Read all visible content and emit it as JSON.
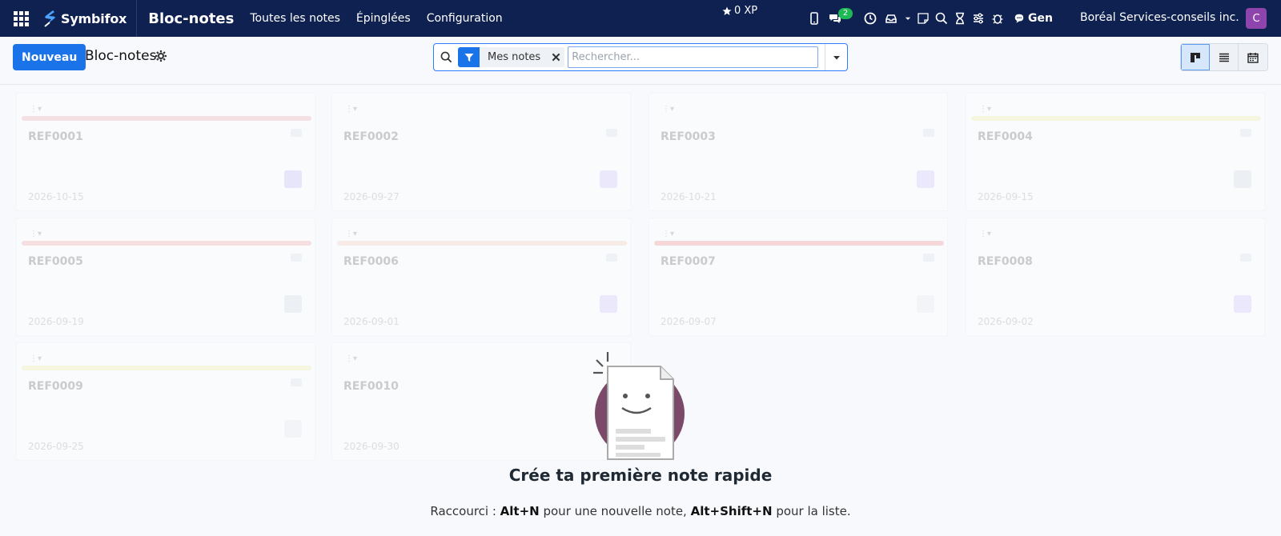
{
  "navbar": {
    "brand": "Symbifox",
    "app_title": "Bloc-notes",
    "menu": [
      "Toutes les notes",
      "Épinglées",
      "Configuration"
    ],
    "xp": "0 XP",
    "chat_badge": "2",
    "gen_label": "Gen",
    "company": "Boréal Services-conseils inc.",
    "avatar_initial": "C",
    "avatar_color": "#8e44ad"
  },
  "control": {
    "new_button": "Nouveau",
    "breadcrumb": "Bloc-notes",
    "search": {
      "facet_label": "Mes notes",
      "placeholder": "Rechercher..."
    },
    "accent_color": "#1a73e8"
  },
  "cards": [
    {
      "ref": "REF0001",
      "date": "2026-10-15",
      "bar_color": "#f1b5b5",
      "chip_color": "#c7c1f5"
    },
    {
      "ref": "REF0002",
      "date": "2026-09-27",
      "bar_color": "",
      "chip_color": "#d3c9f8"
    },
    {
      "ref": "REF0003",
      "date": "2026-10-21",
      "bar_color": "",
      "chip_color": "#d3c9f8"
    },
    {
      "ref": "REF0004",
      "date": "2026-09-15",
      "bar_color": "#f5efaa",
      "chip_color": "#d8dde3"
    },
    {
      "ref": "REF0005",
      "date": "2026-09-19",
      "bar_color": "#f5b1b1",
      "chip_color": "#d8dde3"
    },
    {
      "ref": "REF0006",
      "date": "2026-09-01",
      "bar_color": "#f7d2c2",
      "chip_color": "#d3c9f8"
    },
    {
      "ref": "REF0007",
      "date": "2026-09-07",
      "bar_color": "#f59c9c",
      "chip_color": "#e9edf1"
    },
    {
      "ref": "REF0008",
      "date": "2026-09-02",
      "bar_color": "",
      "chip_color": "#d3c9f8"
    },
    {
      "ref": "REF0009",
      "date": "2026-09-25",
      "bar_color": "#f5efaa",
      "chip_color": "#e9edf1"
    },
    {
      "ref": "REF0010",
      "date": "2026-09-30",
      "bar_color": "",
      "chip_color": ""
    }
  ],
  "empty_state": {
    "title": "Crée ta première note rapide",
    "help_prefix": "Raccourci : ",
    "shortcut_1": "Alt+N",
    "help_middle": " pour une nouvelle note, ",
    "shortcut_2": "Alt+Shift+N",
    "help_suffix": " pour la liste."
  }
}
